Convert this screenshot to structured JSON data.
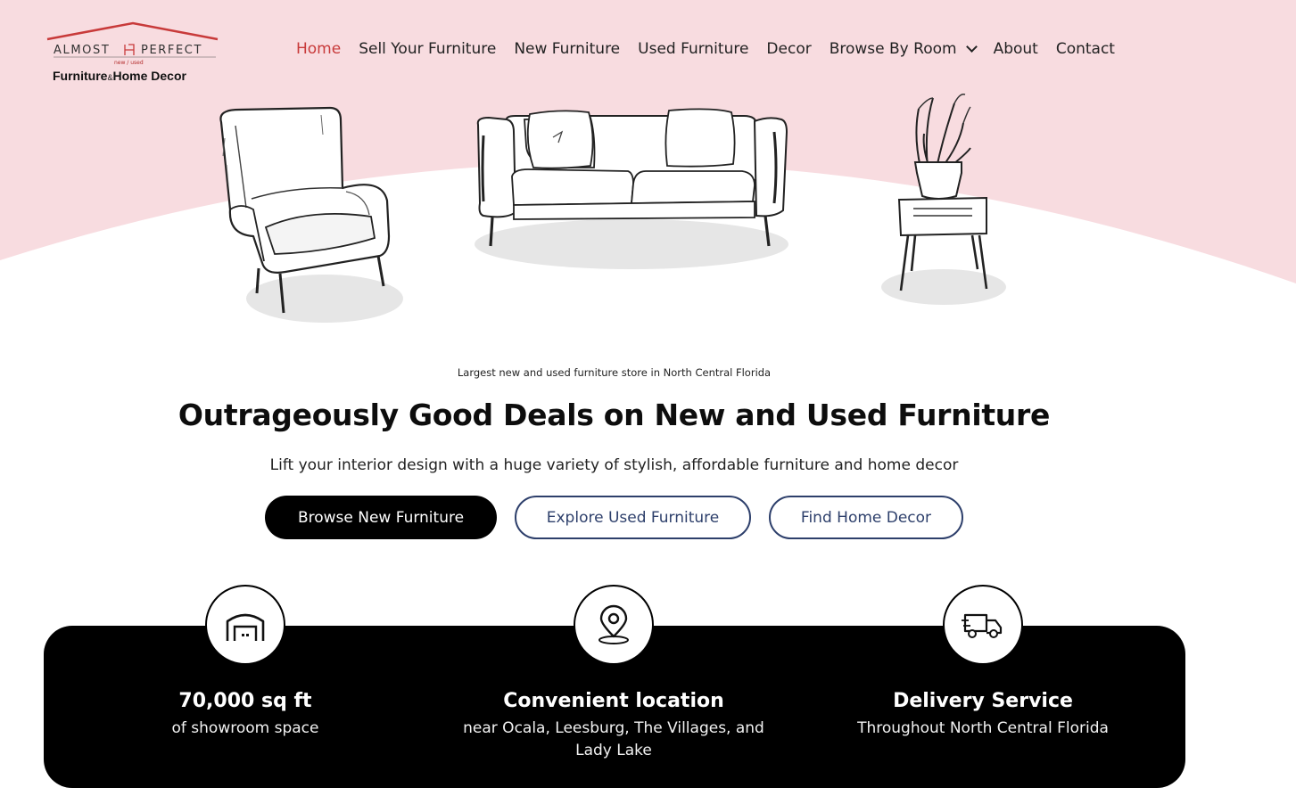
{
  "brand": {
    "word_left": "ALMOST",
    "word_right": "PERFECT",
    "sub": "new / used",
    "tag_main": "Furniture",
    "tag_amp": "&",
    "tag_end": "Home Decor",
    "roof_color": "#c83a3a"
  },
  "nav": {
    "items": [
      {
        "label": "Home",
        "active": true
      },
      {
        "label": "Sell Your Furniture"
      },
      {
        "label": "New Furniture"
      },
      {
        "label": "Used Furniture"
      },
      {
        "label": "Decor"
      },
      {
        "label": "Browse By Room",
        "dropdown": true
      },
      {
        "label": "About"
      },
      {
        "label": "Contact"
      }
    ]
  },
  "hero": {
    "background_color": "#f8dce0",
    "tagline": "Largest new and used furniture store in North Central Florida",
    "headline": "Outrageously Good Deals on New and Used Furniture",
    "subhead": "Lift your interior design with a huge variety of stylish, affordable furniture and home decor",
    "illustrations": [
      "armchair-illustration",
      "sofa-illustration",
      "side-table-plant-illustration"
    ]
  },
  "cta": {
    "primary": "Browse New Furniture",
    "secondary": "Explore Used Furniture",
    "tertiary": "Find Home Decor",
    "outline_color": "#2d3f6b"
  },
  "features": [
    {
      "icon": "warehouse-icon",
      "title": "70,000 sq ft",
      "desc": "of showroom space"
    },
    {
      "icon": "location-pin-icon",
      "title": "Convenient location",
      "desc": "near Ocala, Leesburg,  The Villages, and Lady Lake"
    },
    {
      "icon": "delivery-truck-icon",
      "title": "Delivery Service",
      "desc": "Throughout North Central Florida"
    }
  ]
}
